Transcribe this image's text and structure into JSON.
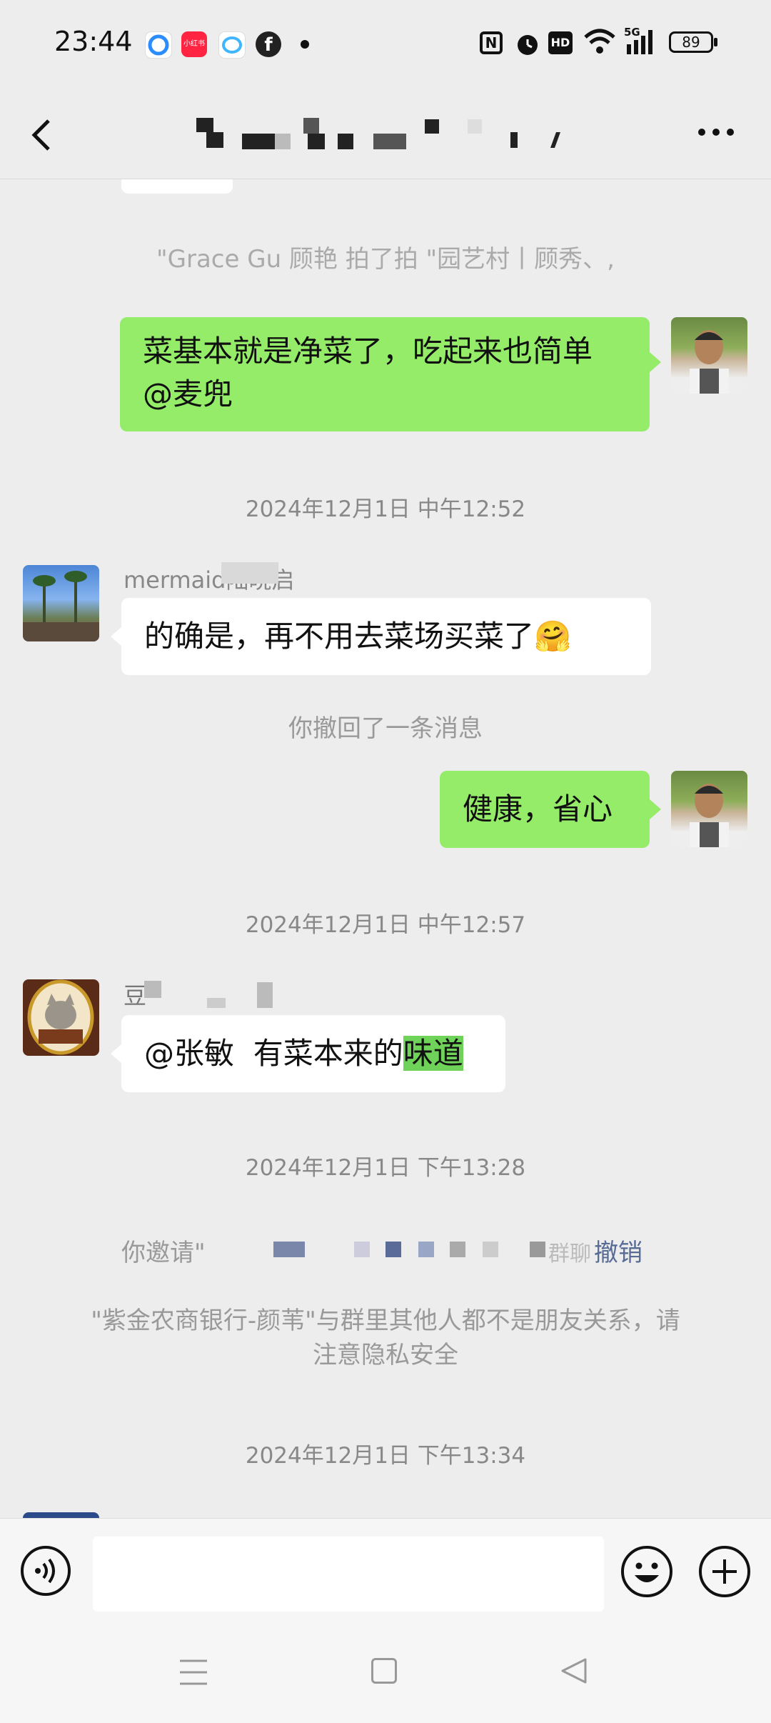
{
  "status_bar": {
    "time": "23:44",
    "battery": "89",
    "network": "5G",
    "apps": [
      {
        "name": "qq-browser-icon",
        "color": "#2b8cff"
      },
      {
        "name": "xiaohongshu-icon",
        "color": "#ff2442",
        "label": "小红书"
      },
      {
        "name": "chat-app-icon",
        "color": "#3fb6ff"
      },
      {
        "name": "facebook-icon",
        "color": "#222222"
      }
    ]
  },
  "header": {
    "title_blurred": true
  },
  "chat": {
    "messages": [
      {
        "type": "system",
        "text": "\"Grace Gu 顾艳  拍了拍 \"园艺村丨顾秀、,"
      },
      {
        "type": "outgoing",
        "lines": [
          "菜基本就是净菜了，吃起来也简单",
          "@麦兜"
        ]
      },
      {
        "type": "time",
        "text": "2024年12月1日 中午12:52"
      },
      {
        "type": "incoming",
        "sender": "mermaid陆晓启",
        "text": "的确是，再不用去菜场买菜了🤗"
      },
      {
        "type": "system",
        "text": "你撤回了一条消息"
      },
      {
        "type": "outgoing",
        "text": "健康，省心"
      },
      {
        "type": "time",
        "text": "2024年12月1日 中午12:57"
      },
      {
        "type": "incoming",
        "sender": "豆",
        "mention": "@张敏",
        "text_plain": "  有菜本来的",
        "text_highlight": "味道"
      },
      {
        "type": "time",
        "text": "2024年12月1日 下午13:28"
      },
      {
        "type": "system",
        "text_prefix": "你邀请\"",
        "text_suffix": "群聊",
        "action": "撤销"
      },
      {
        "type": "system",
        "lines": [
          "\"紫金农商银行-颜苇\"与群里其他人都不是朋友关系，请",
          "注意隐私安全"
        ]
      },
      {
        "type": "time",
        "text": "2024年12月1日 下午13:34"
      }
    ]
  },
  "input_bar": {
    "voice_icon": "voice-icon",
    "emoji_icon": "emoji-icon",
    "add_icon": "add-icon",
    "placeholder": ""
  },
  "nav_bar": {
    "menu_icon": "menu-icon",
    "home_icon": "home-icon",
    "back_icon": "back-triangle-icon"
  },
  "colors": {
    "background": "#ededed",
    "bubble_out": "#95ec69",
    "bubble_in": "#ffffff",
    "link": "#576b95",
    "highlight": "#6fd35a"
  }
}
